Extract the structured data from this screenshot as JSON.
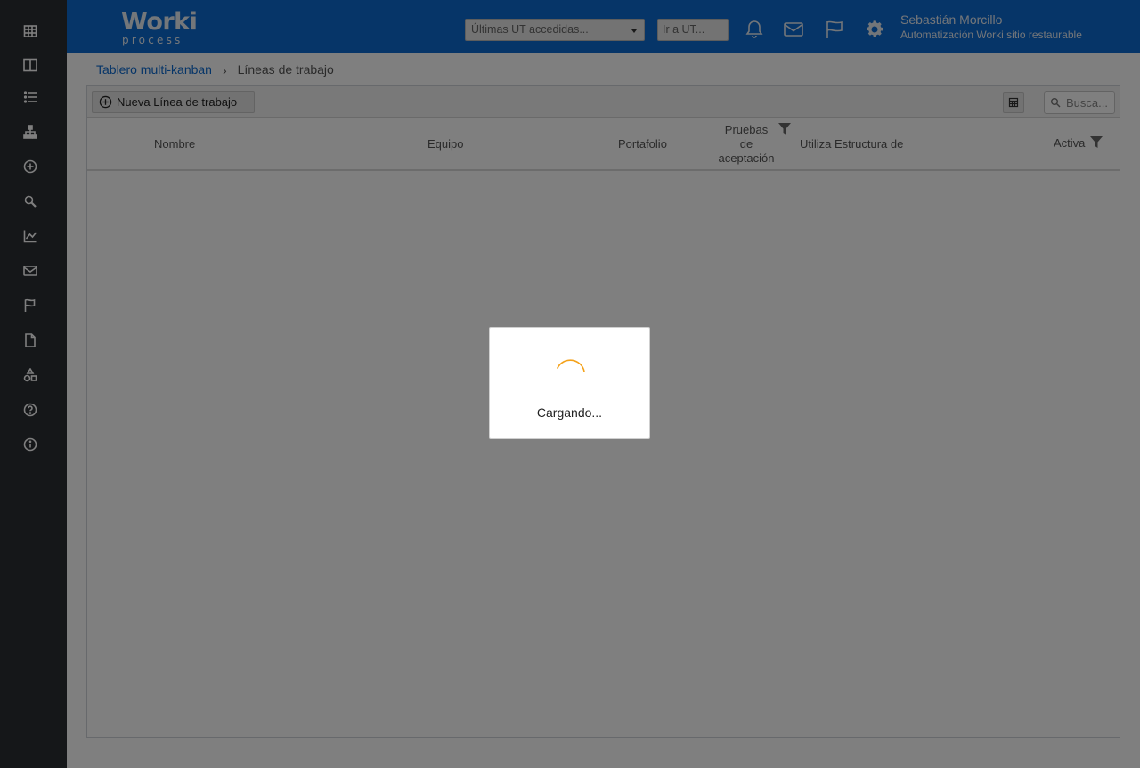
{
  "brand": {
    "logo_main": "Worki",
    "logo_sub": "process",
    "primary_color": "#0d6ad0",
    "sidebar_color": "#2b2e33",
    "spinner_color": "#f4a21b"
  },
  "sidebar": {
    "items": [
      {
        "icon": "table-grid-icon"
      },
      {
        "icon": "columns-icon"
      },
      {
        "icon": "list-icon"
      },
      {
        "icon": "sitemap-icon"
      },
      {
        "icon": "plus-circle-icon"
      },
      {
        "icon": "search-icon"
      },
      {
        "icon": "line-chart-icon"
      },
      {
        "icon": "envelope-icon"
      },
      {
        "icon": "flag-icon"
      },
      {
        "icon": "document-icon"
      },
      {
        "icon": "shapes-icon"
      },
      {
        "icon": "help-icon"
      },
      {
        "icon": "info-icon"
      }
    ]
  },
  "header": {
    "recent_select": "Últimas UT accedidas...",
    "goto_placeholder": "Ir a UT...",
    "user_name": "Sebastián Morcillo",
    "user_site": "Automatización Worki sitio restaurable"
  },
  "breadcrumb": {
    "parent": "Tablero multi-kanban",
    "current": "Líneas de trabajo"
  },
  "toolbar": {
    "new_button": "Nueva Línea de trabajo",
    "search_placeholder": "Busca..."
  },
  "table": {
    "columns": {
      "name": "Nombre",
      "team": "Equipo",
      "portfolio": "Portafolio",
      "acceptance_1": "Pruebas",
      "acceptance_2": "de",
      "acceptance_3": "aceptación",
      "structure": "Utiliza Estructura de",
      "active": "Activa"
    }
  },
  "loading": {
    "text": "Cargando..."
  }
}
